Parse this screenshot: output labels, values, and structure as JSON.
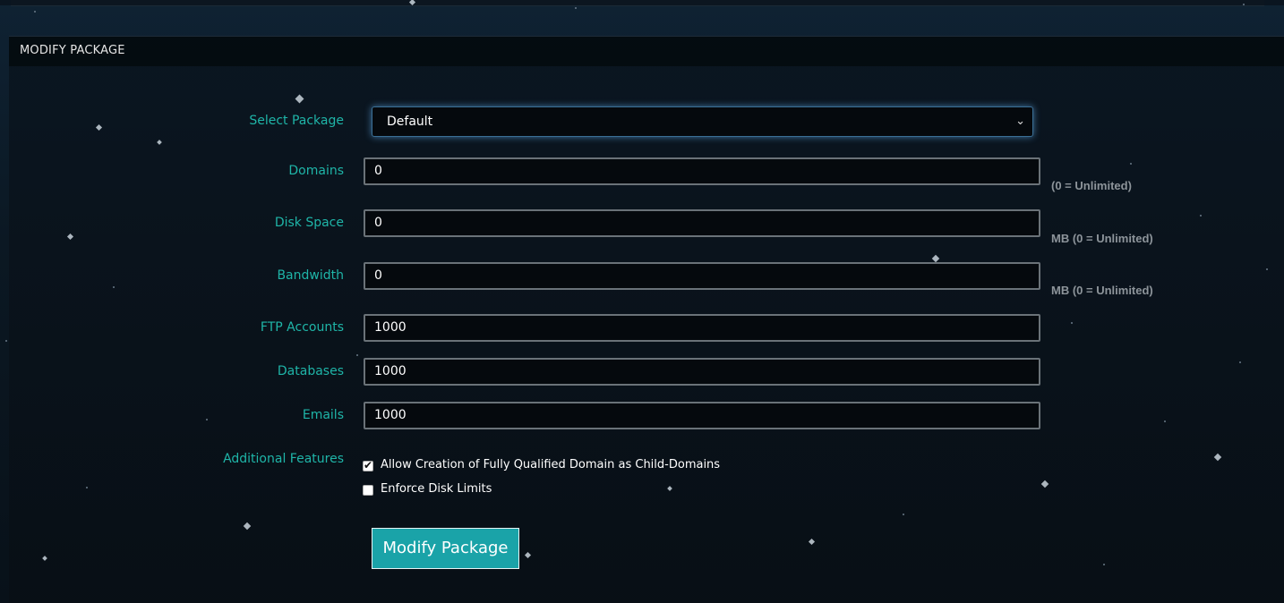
{
  "panel": {
    "title": "MODIFY PACKAGE"
  },
  "form": {
    "select_package": {
      "label": "Select Package",
      "value": "Default"
    },
    "domains": {
      "label": "Domains",
      "value": "0",
      "hint": "(0 = Unlimited)"
    },
    "disk_space": {
      "label": "Disk Space",
      "value": "0",
      "hint": "MB (0 = Unlimited)"
    },
    "bandwidth": {
      "label": "Bandwidth",
      "value": "0",
      "hint": "MB (0 = Unlimited)"
    },
    "ftp_accounts": {
      "label": "FTP Accounts",
      "value": "1000"
    },
    "databases": {
      "label": "Databases",
      "value": "1000"
    },
    "emails": {
      "label": "Emails",
      "value": "1000"
    },
    "additional_features": {
      "label": "Additional Features",
      "options": [
        {
          "label": "Allow Creation of Fully Qualified Domain as Child-Domains",
          "checked": true
        },
        {
          "label": "Enforce Disk Limits",
          "checked": false
        }
      ]
    },
    "submit_label": "Modify Package"
  },
  "colors": {
    "accent": "#1fb5a8",
    "button": "#1aa3a8",
    "background": "#0b1823"
  }
}
